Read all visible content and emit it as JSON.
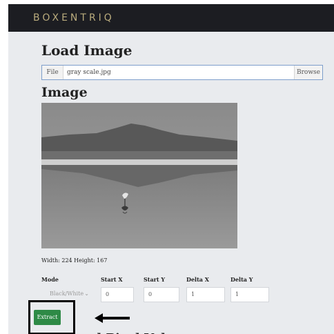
{
  "header": {
    "brand": "BOXENTRIQ"
  },
  "load_section": {
    "title": "Load Image",
    "file_label": "File",
    "file_name": "gray scale.jpg",
    "browse_label": "Browse"
  },
  "image_section": {
    "title": "Image",
    "dimensions_text": "Width: 224 Height: 167"
  },
  "controls": {
    "mode_label": "Mode",
    "mode_value": "Black/White",
    "start_x_label": "Start X",
    "start_x_value": "0",
    "start_y_label": "Start Y",
    "start_y_value": "0",
    "delta_x_label": "Delta X",
    "delta_x_value": "1",
    "delta_y_label": "Delta Y",
    "delta_y_value": "1",
    "extract_label": "Extract"
  },
  "colors": {
    "accent_green": "#2e8a46",
    "topbar": "#1c1d22",
    "brand": "#b9ab7d"
  },
  "icons": {
    "dropdown": "chevron-down-icon",
    "annotation": "arrow-left-icon"
  }
}
